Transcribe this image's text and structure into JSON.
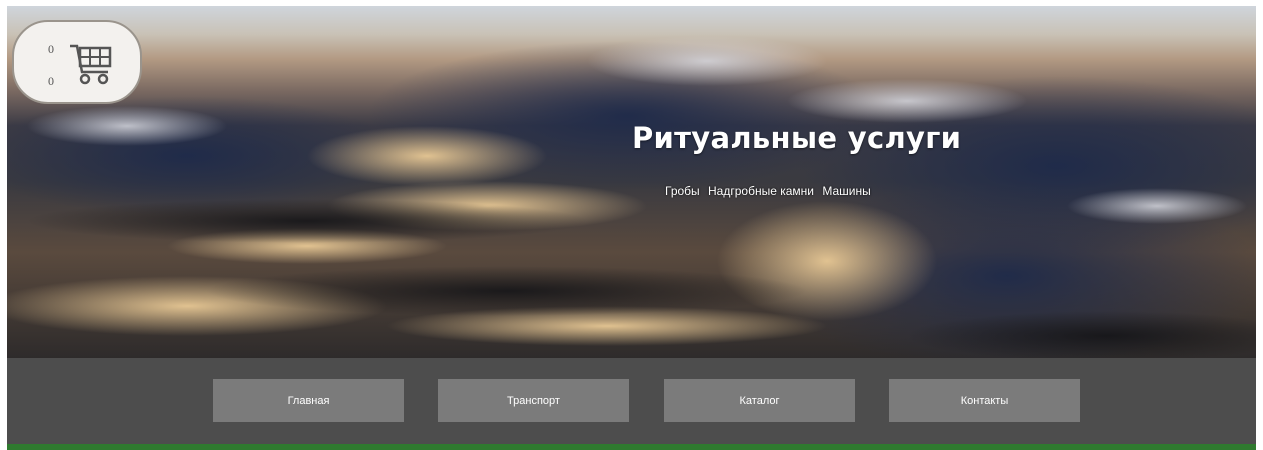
{
  "cart": {
    "count": "0",
    "total": "0"
  },
  "hero": {
    "title": "Ритуальные услуги",
    "subtitle_items": [
      "Гробы",
      "Надгробные камни",
      "Машины"
    ]
  },
  "nav": {
    "items": [
      {
        "label": "Главная"
      },
      {
        "label": "Транспорт"
      },
      {
        "label": "Каталог"
      },
      {
        "label": "Контакты"
      }
    ]
  },
  "colors": {
    "nav_bg": "#4d4d4d",
    "nav_button": "#7b7b7b",
    "bottom_bar": "#2f7a2f",
    "cart_bg": "#f3f1ee"
  },
  "icons": {
    "cart": "shopping-cart-icon"
  }
}
